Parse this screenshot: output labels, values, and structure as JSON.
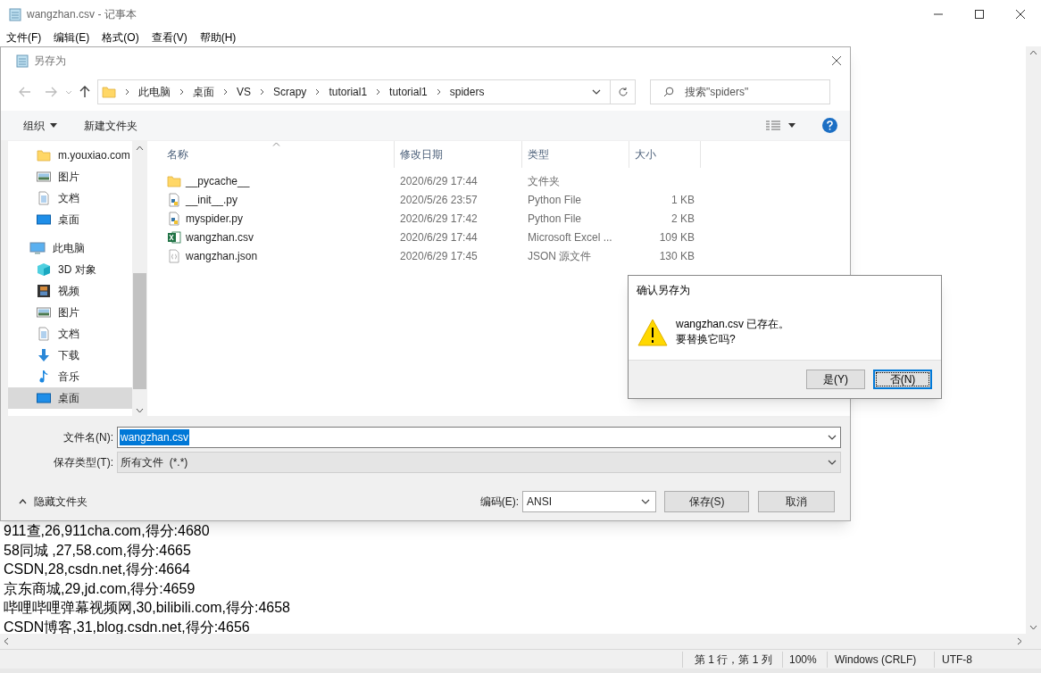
{
  "window": {
    "title": "wangzhan.csv - 记事本"
  },
  "menu": [
    "文件(F)",
    "编辑(E)",
    "格式(O)",
    "查看(V)",
    "帮助(H)"
  ],
  "document": {
    "lines": [
      "911查,26,911cha.com,得分:4680",
      "58同城 ,27,58.com,得分:4665",
      "CSDN,28,csdn.net,得分:4664",
      "京东商城,29,jd.com,得分:4659",
      "哔哩哔哩弹幕视频网,30,bilibili.com,得分:4658",
      "CSDN博客,31,blog.csdn.net,得分:4656"
    ]
  },
  "status_bar": {
    "position": "第 1 行，第 1 列",
    "zoom": "100%",
    "line_ending": "Windows (CRLF)",
    "encoding": "UTF-8"
  },
  "save_dialog": {
    "title": "另存为",
    "breadcrumbs": [
      "此电脑",
      "桌面",
      "VS",
      "Scrapy",
      "tutorial1",
      "tutorial1",
      "spiders"
    ],
    "search": {
      "placeholder": "搜索\"spiders\""
    },
    "toolbar": {
      "organize": "组织",
      "new_folder": "新建文件夹"
    },
    "sidebar": {
      "items": [
        {
          "label": "m.youxiao.com",
          "kind": "folder",
          "selected": false
        },
        {
          "label": "图片",
          "kind": "pictures",
          "selected": false
        },
        {
          "label": "文档",
          "kind": "documents",
          "selected": false
        },
        {
          "label": "桌面",
          "kind": "desktop",
          "selected": false
        },
        {
          "label": "此电脑",
          "kind": "pc",
          "selected": false,
          "children": [
            {
              "label": "3D 对象",
              "kind": "cube",
              "selected": false
            },
            {
              "label": "视频",
              "kind": "video",
              "selected": false
            },
            {
              "label": "图片",
              "kind": "pictures",
              "selected": false
            },
            {
              "label": "文档",
              "kind": "documents",
              "selected": false
            },
            {
              "label": "下载",
              "kind": "downloads",
              "selected": false
            },
            {
              "label": "音乐",
              "kind": "music",
              "selected": false
            },
            {
              "label": "桌面",
              "kind": "desktop",
              "selected": true
            }
          ]
        }
      ]
    },
    "columns": [
      {
        "label": "名称",
        "sorted": true
      },
      {
        "label": "修改日期",
        "sorted": false
      },
      {
        "label": "类型",
        "sorted": false
      },
      {
        "label": "大小",
        "sorted": false
      }
    ],
    "files": [
      {
        "name": "__pycache__",
        "kind": "folder",
        "date": "2020/6/29 17:44",
        "type": "文件夹"
      },
      {
        "name": "__init__.py",
        "kind": "python",
        "date": "2020/5/26 23:57",
        "type": "Python File",
        "size": "1 KB"
      },
      {
        "name": "myspider.py",
        "kind": "python",
        "date": "2020/6/29 17:42",
        "type": "Python File",
        "size": "2 KB"
      },
      {
        "name": "wangzhan.csv",
        "kind": "excel",
        "date": "2020/6/29 17:44",
        "type": "Microsoft Excel ...",
        "size": "109 KB"
      },
      {
        "name": "wangzhan.json",
        "kind": "json",
        "date": "2020/6/29 17:45",
        "type": "JSON 源文件",
        "size": "130 KB"
      }
    ],
    "file_name": {
      "label": "文件名(N):",
      "value": "wangzhan.csv",
      "text_selected": true
    },
    "file_type": {
      "label": "保存类型(T):",
      "value": "所有文件  (*.*)"
    },
    "hide_folders": "隐藏文件夹",
    "encoding": {
      "label": "编码(E):",
      "value": "ANSI"
    },
    "buttons": [
      "保存(S)",
      "取消"
    ]
  },
  "confirm_dialog": {
    "title": "确认另存为",
    "message": [
      "wangzhan.csv 已存在。",
      "要替换它吗?"
    ],
    "buttons": [
      {
        "label": "是(Y)",
        "focused": false
      },
      {
        "label": "否(N)",
        "focused": true
      }
    ]
  }
}
